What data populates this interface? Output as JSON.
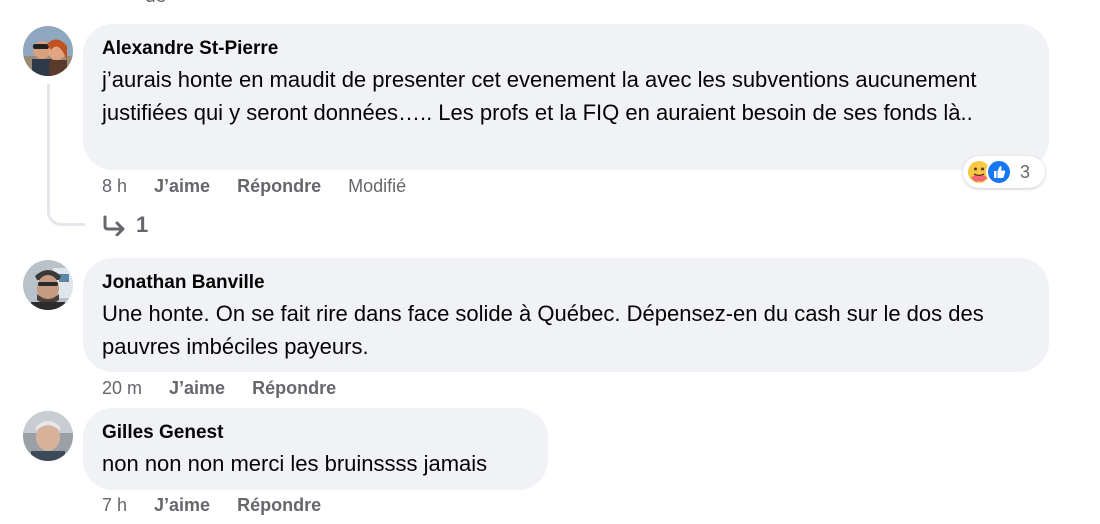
{
  "top_fragment": "dé",
  "comments": [
    {
      "author": "Alexandre St-Pierre",
      "text": "j’aurais honte en maudit de presenter cet evenement la avec les subventions aucunement justifiées qui y seront données….. Les profs et la FIQ en auraient besoin de ses fonds là..",
      "time": "8 h",
      "like": "J’aime",
      "reply": "Répondre",
      "edited": "Modifié",
      "reactions": {
        "icons": [
          "care-reaction",
          "like-reaction"
        ],
        "count": "3"
      },
      "replies_count": "1"
    },
    {
      "author": "Jonathan Banville",
      "text": "Une honte. On se fait rire dans face solide à Québec. Dépensez-en du cash sur le dos des pauvres imbéciles payeurs.",
      "time": "20 m",
      "like": "J’aime",
      "reply": "Répondre"
    },
    {
      "author": "Gilles Genest",
      "text": "non non non merci les bruinssss jamais",
      "time": "7 h",
      "like": "J’aime",
      "reply": "Répondre"
    }
  ],
  "colors": {
    "bubble": "#f0f2f5",
    "secondary_text": "#65676b",
    "primary_text": "#050505",
    "like_blue": "#1877f2",
    "care_yellow": "#f7c845"
  }
}
